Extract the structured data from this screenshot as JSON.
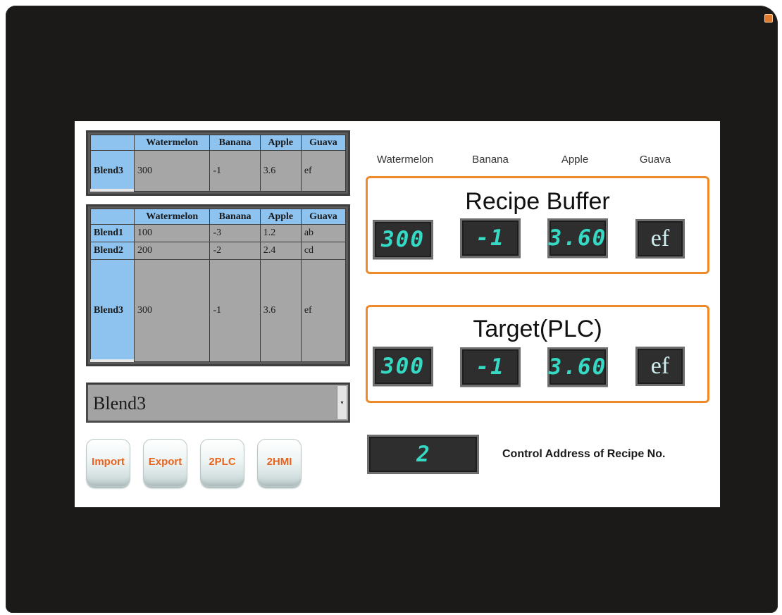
{
  "columns": [
    "Watermelon",
    "Banana",
    "Apple",
    "Guava"
  ],
  "current_table": {
    "rows": [
      {
        "name": "Blend3",
        "values": [
          "300",
          "-1",
          "3.6",
          "ef"
        ]
      }
    ]
  },
  "recipe_table": {
    "rows": [
      {
        "name": "Blend1",
        "values": [
          "100",
          "-3",
          "1.2",
          "ab"
        ]
      },
      {
        "name": "Blend2",
        "values": [
          "200",
          "-2",
          "2.4",
          "cd"
        ]
      },
      {
        "name": "Blend3",
        "values": [
          "300",
          "-1",
          "3.6",
          "ef"
        ]
      }
    ]
  },
  "dropdown": {
    "selected": "Blend3",
    "arrow": "▾"
  },
  "buttons": {
    "import": "Import",
    "export": "Export",
    "to_plc": "2PLC",
    "to_hmi": "2HMI"
  },
  "buffer_headers": [
    "Watermelon",
    "Banana",
    "Apple",
    "Guava"
  ],
  "recipe_buffer": {
    "title": "Recipe Buffer",
    "watermelon": "300",
    "banana": "-1",
    "apple": "3.60",
    "guava": "ef"
  },
  "target_plc": {
    "title": "Target(PLC)",
    "watermelon": "300",
    "banana": "-1",
    "apple": "3.60",
    "guava": "ef"
  },
  "control": {
    "value": "2",
    "label": "Control Address of Recipe No."
  },
  "colors": {
    "bezel": "#1b1a18",
    "panel_border": "#ee8a2a",
    "segment_text": "#35d9c4",
    "button_text": "#e8641e",
    "header_blue": "#8ec3ef"
  }
}
